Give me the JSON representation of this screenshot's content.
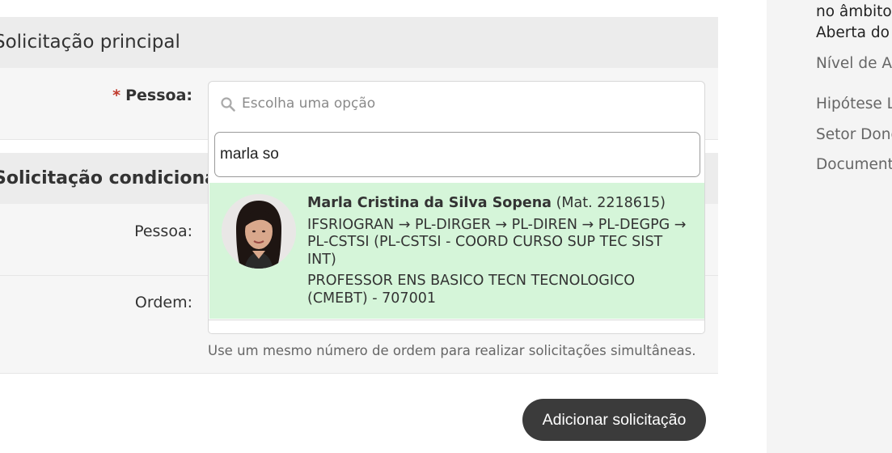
{
  "sections": {
    "principal_title": "Solicitação principal",
    "condicionada_title": "Solicitação condicionada"
  },
  "form": {
    "pessoa_required_marker": "*",
    "pessoa_label": "Pessoa:",
    "pessoa_placeholder": "Escolha uma opção",
    "pessoa2_label": "Pessoa:",
    "ordem_label": "Ordem:",
    "ordem_help": "Use um mesmo número de ordem para realizar solicitações simultâneas.",
    "add_button": "Adicionar solicitação"
  },
  "dropdown": {
    "search_value": "marla so",
    "option": {
      "name": "Marla Cristina da Silva Sopena",
      "matricula": "(Mat. 2218615)",
      "unit_path": "IFSRIOGRAN → PL-DIRGER → PL-DIREN → PL-DEGPG → PL-CSTSI (PL-CSTSI - COORD CURSO SUP TEC SIST INT)",
      "role": "PROFESSOR ENS BASICO TECN TECNOLOGICO (CMEBT) - 707001"
    }
  },
  "sidebar": {
    "line1": "no âmbito",
    "line2": "Aberta do",
    "nivel": "Nível de Ac",
    "hipotese": "Hipótese Le",
    "setor": "Setor Dono",
    "documento": "Documento"
  },
  "colors": {
    "option_highlight": "#d5f5d9",
    "button_bg": "#3b3b3b",
    "required": "#c0392b"
  }
}
